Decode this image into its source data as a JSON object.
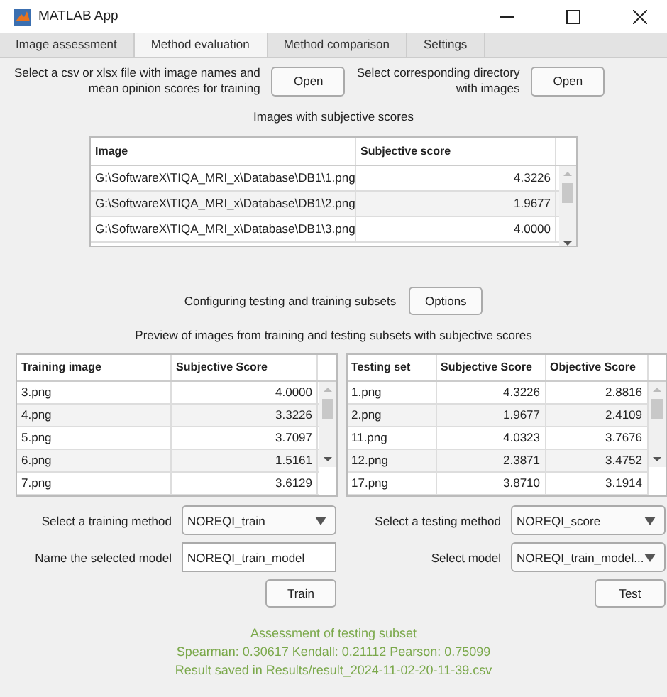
{
  "window": {
    "title": "MATLAB App"
  },
  "tabs": [
    {
      "label": "Image assessment",
      "selected": false
    },
    {
      "label": "Method evaluation",
      "selected": true
    },
    {
      "label": "Method comparison",
      "selected": false
    },
    {
      "label": "Settings",
      "selected": false
    }
  ],
  "file_selection": [
    {
      "prompt": "Select a csv or xlsx file with image names and\nmean opinion scores for training",
      "button": "Open"
    },
    {
      "prompt": "Select corresponding directory\nwith images",
      "button": "Open"
    }
  ],
  "images_heading": "Images with subjective scores",
  "images_table": {
    "columns": [
      "Image",
      "Subjective score"
    ],
    "rows": [
      [
        "G:\\SoftwareX\\TIQA_MRI_x\\Database\\DB1\\1.png",
        "4.3226"
      ],
      [
        "G:\\SoftwareX\\TIQA_MRI_x\\Database\\DB1\\2.png",
        "1.9677"
      ],
      [
        "G:\\SoftwareX\\TIQA_MRI_x\\Database\\DB1\\3.png",
        "4.0000"
      ]
    ]
  },
  "subsets": {
    "label": "Configuring testing and training subsets",
    "button": "Options"
  },
  "preview_heading": "Preview of images from training and testing subsets with subjective scores",
  "training_table": {
    "columns": [
      "Training image",
      "Subjective Score"
    ],
    "rows": [
      [
        "3.png",
        "4.0000"
      ],
      [
        "4.png",
        "3.3226"
      ],
      [
        "5.png",
        "3.7097"
      ],
      [
        "6.png",
        "1.5161"
      ],
      [
        "7.png",
        "3.6129"
      ]
    ]
  },
  "testing_table": {
    "columns": [
      "Testing set",
      "Subjective Score",
      "Objective Score"
    ],
    "rows": [
      [
        "1.png",
        "4.3226",
        "2.8816"
      ],
      [
        "2.png",
        "1.9677",
        "2.4109"
      ],
      [
        "11.png",
        "4.0323",
        "3.7676"
      ],
      [
        "12.png",
        "2.3871",
        "3.4752"
      ],
      [
        "17.png",
        "3.8710",
        "3.1914"
      ]
    ]
  },
  "training": {
    "method_label": "Select a training method",
    "method": "NOREQI_train",
    "model_label": "Name the selected model",
    "model_name": "NOREQI_train_model",
    "button": "Train"
  },
  "testing": {
    "method_label": "Select a testing method",
    "method": "NOREQI_score",
    "model_label": "Select model",
    "model": "NOREQI_train_model...",
    "button": "Test"
  },
  "result": [
    "Assessment of testing subset",
    "Spearman: 0.30617 Kendall: 0.21112 Pearson: 0.75099",
    "Result saved in Results/result_2024-11-02-20-11-39.csv"
  ]
}
